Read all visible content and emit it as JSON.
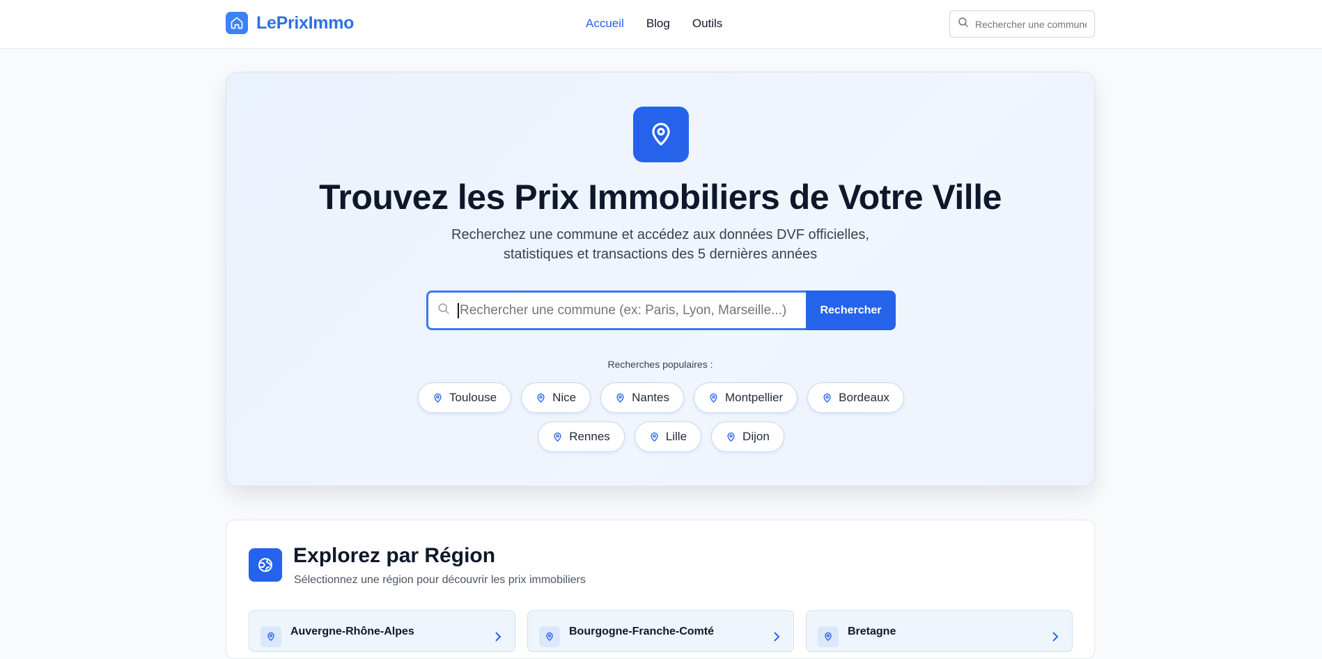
{
  "header": {
    "logo_text": "LePrixImmo",
    "nav": [
      {
        "label": "Accueil",
        "active": true
      },
      {
        "label": "Blog",
        "active": false
      },
      {
        "label": "Outils",
        "active": false
      }
    ],
    "search_placeholder": "Rechercher une commune"
  },
  "hero": {
    "title": "Trouvez les Prix Immobiliers de Votre Ville",
    "subtitle_line1": "Recherchez une commune et accédez aux données DVF officielles,",
    "subtitle_line2": "statistiques et transactions des 5 dernières années",
    "search_placeholder": "Rechercher une commune (ex: Paris, Lyon, Marseille...)",
    "search_button": "Rechercher",
    "popular_label": "Recherches populaires :",
    "popular": [
      "Toulouse",
      "Nice",
      "Nantes",
      "Montpellier",
      "Bordeaux",
      "Rennes",
      "Lille",
      "Dijon"
    ]
  },
  "regions": {
    "title": "Explorez par Région",
    "subtitle": "Sélectionnez une région pour découvrir les prix immobiliers",
    "items": [
      "Auvergne-Rhône-Alpes",
      "Bourgogne-Franche-Comté",
      "Bretagne"
    ]
  },
  "colors": {
    "accent": "#2563eb",
    "logo": "#2f6fe0",
    "page_bg": "#f8fafc"
  },
  "icons": {
    "logo": "home-icon",
    "hero": "map-pin-icon",
    "search": "search-icon",
    "region": "globe-icon",
    "chevron": "chevron-right-icon"
  }
}
